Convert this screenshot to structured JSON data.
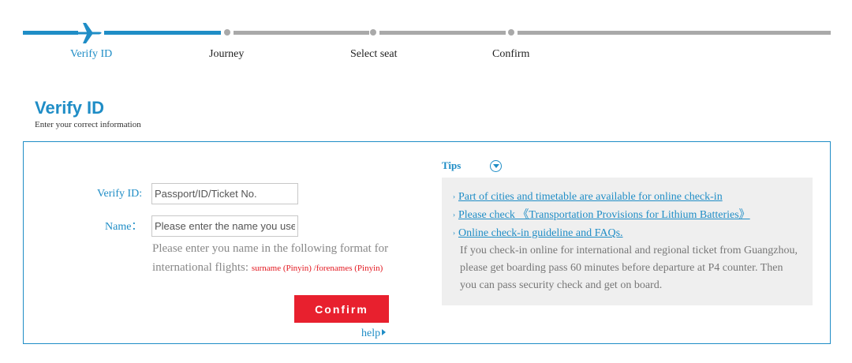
{
  "steps": [
    {
      "label": "Verify ID"
    },
    {
      "label": "Journey"
    },
    {
      "label": "Select seat"
    },
    {
      "label": "Confirm"
    }
  ],
  "header": {
    "title": "Verify ID",
    "subtitle": "Enter your correct information"
  },
  "form": {
    "id_label": "Verify ID:",
    "id_placeholder": "Passport/ID/Ticket No.",
    "name_label": "Name：",
    "name_placeholder": "Please enter the name you used",
    "hint_prefix": "Please enter you name in the following format for international flights: ",
    "hint_surname": "surname (Pinyin)",
    "hint_sep": " /",
    "hint_forenames": "forenames (Pinyin)",
    "confirm_label": "Confirm",
    "help_label": "help"
  },
  "tips": {
    "title": "Tips",
    "links": [
      "Part of cities and timetable are available for online check-in",
      "Please check 《Transportation Provisions for Lithium Batteries》",
      "Online check-in guideline and FAQs."
    ],
    "note": "If you check-in online for international and regional ticket from Guangzhou, please get boarding pass 60 minutes before departure at P4 counter. Then you can pass security check and get on board."
  },
  "colors": {
    "accent": "#1f8dc6",
    "button": "#e8202e",
    "inactive_step_line": "#a9a9a9",
    "tips_background": "#efefef",
    "hint_red": "#e3171f"
  },
  "icons": {
    "current_step": "airplane-icon",
    "step_marker": "dot-icon",
    "tips_toggle": "chevron-down-circle-icon",
    "link_bullet": "arrow-right-icon",
    "help_arrow": "triangle-right-icon"
  }
}
